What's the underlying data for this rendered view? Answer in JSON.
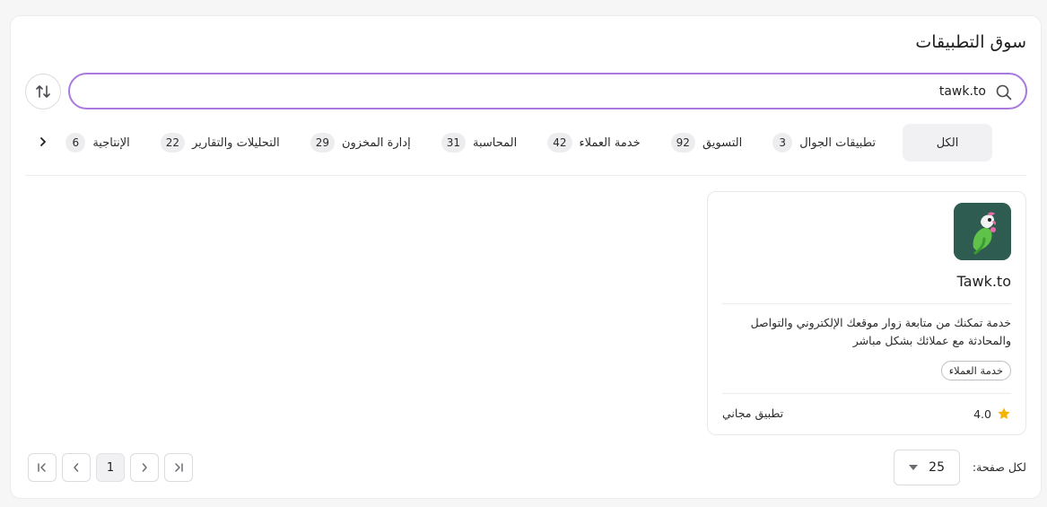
{
  "page": {
    "title": "سوق التطبيقات"
  },
  "search": {
    "value": "tawk.to",
    "icon": "search-icon"
  },
  "tabs": [
    {
      "label": "الكل",
      "count": null,
      "active": true
    },
    {
      "label": "تطبيقات الجوال",
      "count": "3"
    },
    {
      "label": "التسويق",
      "count": "92"
    },
    {
      "label": "خدمة العملاء",
      "count": "42"
    },
    {
      "label": "المحاسبة",
      "count": "31"
    },
    {
      "label": "إدارة المخزون",
      "count": "29"
    },
    {
      "label": "التحليلات والتقارير",
      "count": "22"
    },
    {
      "label": "الإنتاجية",
      "count": "6"
    }
  ],
  "apps": [
    {
      "name": "Tawk.to",
      "description": "خدمة تمكنك من متابعة زوار موقعك الإلكتروني والتواصل والمحادثة مع عملائك بشكل مباشر",
      "tag": "خدمة العملاء",
      "rating": "4.0",
      "price": "تطبيق مجاني"
    }
  ],
  "pagination": {
    "per_page_label": "لكل صفحة:",
    "per_page": "25",
    "current_page": "1"
  },
  "colors": {
    "accent": "#a979e0",
    "star": "#f5b400",
    "logo_bg": "#2f5c50"
  }
}
